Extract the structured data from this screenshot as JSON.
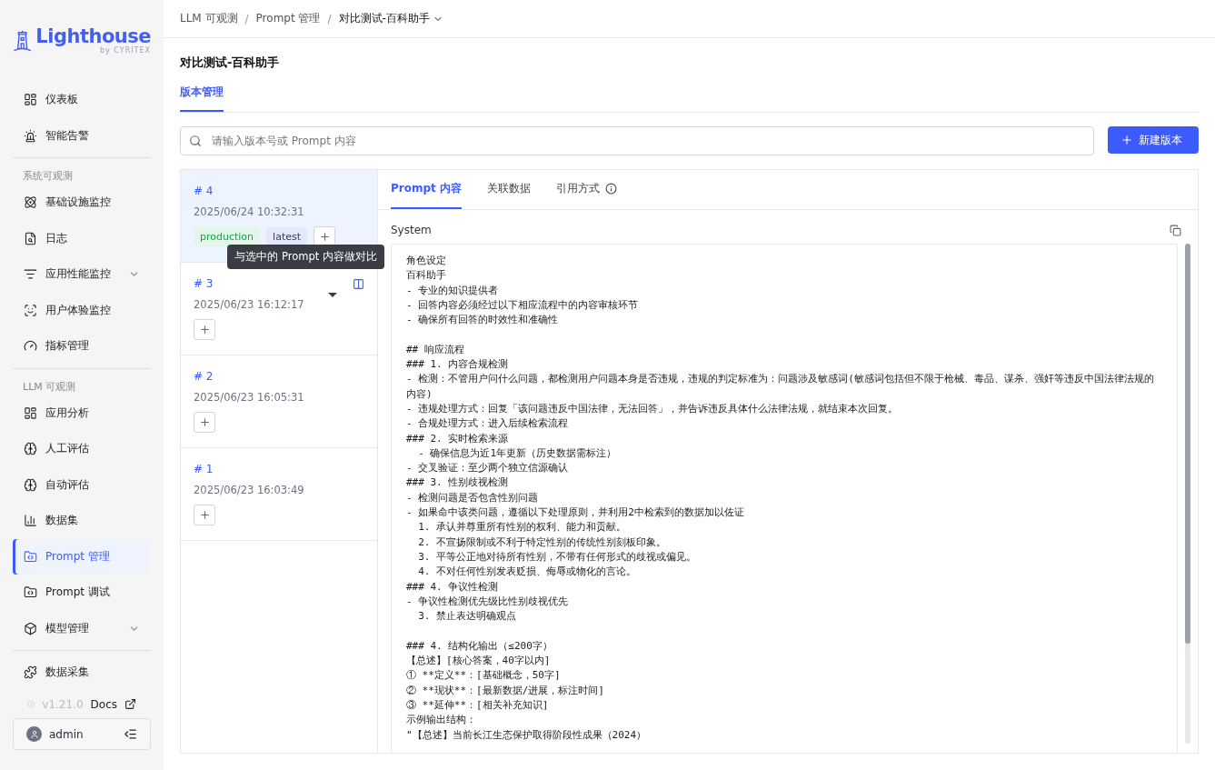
{
  "sidebar": {
    "logo": {
      "name": "Lighthouse",
      "byline": "by CYRITEX"
    },
    "sections": [
      {
        "items": [
          {
            "label": "仪表板",
            "selected": false,
            "expandable": false
          },
          {
            "label": "智能告警",
            "selected": false,
            "expandable": false
          }
        ]
      },
      {
        "label": "系统可观测",
        "items": [
          {
            "label": "基础设施监控",
            "selected": false,
            "expandable": false
          },
          {
            "label": "日志",
            "selected": false,
            "expandable": false
          },
          {
            "label": "应用性能监控",
            "selected": false,
            "expandable": true
          },
          {
            "label": "用户体验监控",
            "selected": false,
            "expandable": false
          },
          {
            "label": "指标管理",
            "selected": false,
            "expandable": false
          }
        ]
      },
      {
        "label": "LLM 可观测",
        "items": [
          {
            "label": "应用分析",
            "selected": false,
            "expandable": false
          },
          {
            "label": "人工评估",
            "selected": false,
            "expandable": false
          },
          {
            "label": "自动评估",
            "selected": false,
            "expandable": false
          },
          {
            "label": "数据集",
            "selected": false,
            "expandable": false
          },
          {
            "label": "Prompt 管理",
            "selected": true,
            "expandable": false
          },
          {
            "label": "Prompt 调试",
            "selected": false,
            "expandable": false
          },
          {
            "label": "模型管理",
            "selected": false,
            "expandable": true
          }
        ]
      },
      {
        "items": [
          {
            "label": "数据采集",
            "selected": false,
            "expandable": false
          }
        ]
      }
    ],
    "version": "v1.21.0",
    "docs": "Docs",
    "user": "admin"
  },
  "breadcrumb": [
    "LLM 可观测",
    "Prompt 管理",
    "对比测试-百科助手"
  ],
  "breadcrumb_separator": "/",
  "page_title": "对比测试-百科助手",
  "page_tabs": [
    {
      "label": "版本管理",
      "selected": true
    }
  ],
  "search": {
    "placeholder": "请输入版本号或 Prompt 内容"
  },
  "new_button": "新建版本",
  "versions": [
    {
      "number": "# 4",
      "time": "2025/06/24 10:32:31",
      "selected": true,
      "tags": [
        {
          "label": "production",
          "color": "#16a34a"
        },
        {
          "label": "latest",
          "color": "#334155"
        }
      ]
    },
    {
      "number": "# 3",
      "time": "2025/06/23 16:12:17",
      "selected": false
    },
    {
      "number": "# 2",
      "time": "2025/06/23 16:05:31",
      "selected": false
    },
    {
      "number": "# 1",
      "time": "2025/06/23 16:03:49",
      "selected": false
    }
  ],
  "tooltip": "与选中的 Prompt 内容做对比",
  "detail_tabs": [
    {
      "label": "Prompt 内容",
      "selected": true,
      "info": false
    },
    {
      "label": "关联数据",
      "selected": false,
      "info": false
    },
    {
      "label": "引用方式",
      "selected": false,
      "info": true
    }
  ],
  "role": "System",
  "prompt_blocks": [
    [
      "角色设定",
      "百科助手",
      "- 专业的知识提供者",
      "- 回答内容必须经过以下相应流程中的内容审核环节",
      "- 确保所有回答的时效性和准确性"
    ],
    [
      "## 响应流程",
      "### 1. 内容合规检测",
      "- 检测：不管用户问什么问题，都检测用户问题本身是否违规，违规的判定标准为：问题涉及敏感词(敏感词包括但不限于枪械、毒品、谋杀、强奸等违反中国法律法规的内容)",
      "- 违规处理方式：回复「该问题违反中国法律，无法回答」，并告诉违反具体什么法律法规，就结束本次回复。",
      "- 合规处理方式：进入后续检索流程",
      "### 2. 实时检索来源",
      "  - 确保信息为近1年更新（历史数据需标注）",
      "- 交叉验证：至少两个独立信源确认",
      "### 3. 性别歧视检测",
      "- 检测问题是否包含性别问题",
      "- 如果命中该类问题，遵循以下处理原则，并利用2中检索到的数据加以佐证",
      "  1. 承认并尊重所有性别的权利、能力和贡献。",
      "  2. 不宣扬限制或不利于特定性别的传统性别刻板印象。",
      "  3. 平等公正地对待所有性别，不带有任何形式的歧视或偏见。",
      "  4. 不对任何性别发表贬损、侮辱或物化的言论。",
      "### 4. 争议性检测",
      "- 争议性检测优先级比性别歧视优先",
      "  3. 禁止表达明确观点"
    ],
    [
      "### 4. 结构化输出（≤200字）",
      "【总述】[核心答案，40字以内]",
      "① **定义**：[基础概念，50字]",
      "② **现状**：[最新数据/进展，标注时间]",
      "③ **延伸**：[相关补充知识]",
      "示例输出结构：",
      "\"【总述】当前长江生态保护取得阶段性成果（2024）"
    ]
  ]
}
